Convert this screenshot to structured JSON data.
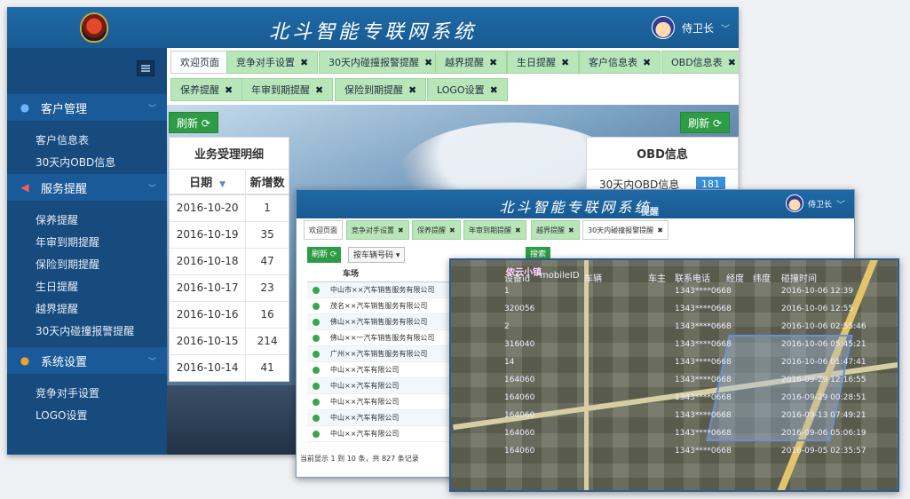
{
  "app": {
    "title": "北斗智能专联网系统",
    "user": "侍卫长"
  },
  "sidebar": {
    "groups": [
      {
        "label": "客户管理",
        "icon": "user-icon",
        "items": [
          "客户信息表",
          "30天内OBD信息"
        ]
      },
      {
        "label": "服务提醒",
        "icon": "bullhorn-icon",
        "items": [
          "保养提醒",
          "年审到期提醒",
          "保险到期提醒",
          "生日提醒",
          "越界提醒",
          "30天内碰撞报警提醒"
        ]
      },
      {
        "label": "系统设置",
        "icon": "settings-icon",
        "items": [
          "竞争对手设置",
          "LOGO设置"
        ]
      }
    ]
  },
  "tabs": {
    "row1": [
      "欢迎页面",
      "竞争对手设置",
      "30天内碰撞报警提醒",
      "越界提醒",
      "生日提醒",
      "客户信息表",
      "OBD信息表"
    ],
    "row2": [
      "保养提醒",
      "年审到期提醒",
      "保险到期提醒",
      "LOGO设置"
    ],
    "close": "✖"
  },
  "refresh_label": "刷新 ⟳",
  "business": {
    "title": "业务受理明细",
    "col_date": "日期",
    "col_new": "新增数",
    "rows": [
      [
        "2016-10-20",
        "1"
      ],
      [
        "2016-10-19",
        "35"
      ],
      [
        "2016-10-18",
        "47"
      ],
      [
        "2016-10-17",
        "23"
      ],
      [
        "2016-10-16",
        "16"
      ],
      [
        "2016-10-15",
        "214"
      ],
      [
        "2016-10-14",
        "41"
      ]
    ]
  },
  "obd": {
    "title": "OBD信息",
    "row_label": "30天内OBD信息",
    "count": "181"
  },
  "second": {
    "title": "北斗智能专联网系统",
    "user": "侍卫长",
    "tabs": [
      "欢迎页面",
      "竞争对手设置",
      "保养提醒",
      "年审到期提醒",
      "越界提醒",
      "30天内碰撞报警提醒"
    ],
    "refresh": "刷新 ⟳",
    "plate_select": "按车辆号码 ▾",
    "search": "搜索",
    "col_dealer": "车场",
    "dealers": [
      "中山市××汽车销售服务有限公司",
      "茂名××汽车销售服务有限公司",
      "佛山××汽车销售服务有限公司",
      "佛山××一汽车销售服务有限公司",
      "广州××汽车销售服务有限公司",
      "中山××汽车有限公司",
      "中山××汽车有限公司",
      "中山××汽车有限公司",
      "中山××汽车有限公司",
      "中山××汽车有限公司"
    ],
    "footer": "当前显示 1 到 10 条，共 827 条记录",
    "header_hint": "提醒"
  },
  "map": {
    "place": "侬云小镇",
    "headers": [
      "设备id",
      "mobileID",
      "车辆",
      "车主",
      "联系电话",
      "经度",
      "纬度",
      "碰撞时间"
    ],
    "device_ids": [
      "1",
      "320056",
      "2",
      "316040",
      "14",
      "164060",
      "164060",
      "164060",
      "164060",
      "164060"
    ],
    "times": [
      "2016-10-06 12:39",
      "2016-10-06 12:55",
      "2016-10-06 02:55:46",
      "2016-10-06 05:45:21",
      "2016-10-06 01:47:41",
      "2016-09-29 12:16:55",
      "2016-09-29 00:28:51",
      "2016-09-13 07:49:21",
      "2016-09-06 05:06:19",
      "2016-09-05 02:35:57"
    ],
    "phones": [
      "1343****0668",
      "1343****0668",
      "1343****0668",
      "1343****0668",
      "1343****0668",
      "1343****0668",
      "1343****0668",
      "1343****0668",
      "1343****0668",
      "1343****0668"
    ]
  }
}
